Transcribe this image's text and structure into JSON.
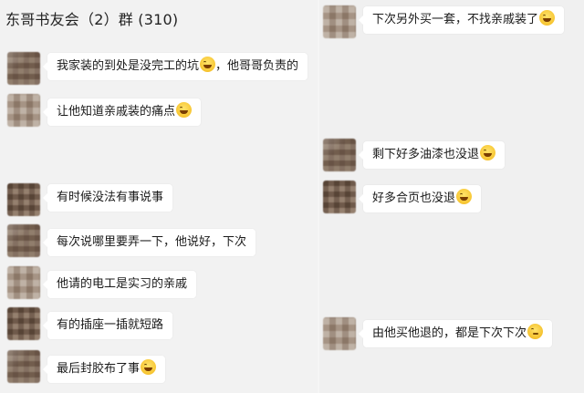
{
  "chat": {
    "title": "东哥书友会（2）群 (310)"
  },
  "left_messages": [
    {
      "text": "我家装的到处是没完工的坑",
      "emoji": "laugh-cry",
      "tail": "，他哥哥负责的"
    },
    {
      "text": "让他知道亲戚装的痛点",
      "emoji": "laugh-cry",
      "tail": ""
    },
    {
      "text": "有时候没法有事说事",
      "emoji": "",
      "tail": ""
    },
    {
      "text": "每次说哪里要弄一下，他说好，下次",
      "emoji": "",
      "tail": ""
    },
    {
      "text": "他请的电工是实习的亲戚",
      "emoji": "",
      "tail": ""
    },
    {
      "text": "有的插座一插就短路",
      "emoji": "",
      "tail": ""
    },
    {
      "text": "最后封胶布了事",
      "emoji": "laugh-cry",
      "tail": ""
    }
  ],
  "right_messages": [
    {
      "text": "下次另外买一套，不找亲戚装了",
      "emoji": "laugh-cry"
    },
    {
      "text": "剩下好多油漆也没退",
      "emoji": "laugh-cry"
    },
    {
      "text": "好多合页也没退",
      "emoji": "laugh-cry"
    },
    {
      "text": "由他买他退的，都是下次下次",
      "emoji": "thinking"
    }
  ]
}
